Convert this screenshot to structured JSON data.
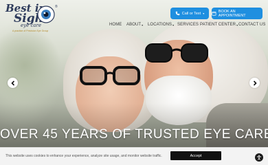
{
  "brand": {
    "logo_line1": "Best in",
    "logo_line2": "Sight",
    "logo_line3": "eye care",
    "logo_tagline": "A practice of Precision Eye Group",
    "registered_mark": "®",
    "logo_color": "#2f3c5c",
    "tagline_color": "#b38a2c"
  },
  "header_buttons": {
    "call": {
      "label": "Call or Text",
      "caret": "▾",
      "icon": "phone-icon"
    },
    "book": {
      "label": "BOOK AN APPOINTMENT",
      "icon": "calendar-icon"
    },
    "color": "#1f8fe0"
  },
  "nav": {
    "items": [
      {
        "label": "HOME",
        "has_menu": false
      },
      {
        "label": "ABOUT",
        "has_menu": true
      },
      {
        "label": "LOCATIONS",
        "has_menu": true
      },
      {
        "label": "SERVICES",
        "has_menu": false
      },
      {
        "label": "PATIENT CENTER",
        "has_menu": true
      },
      {
        "label": "CONTACT US",
        "has_menu": false
      }
    ],
    "caret": "▾"
  },
  "hero": {
    "headline": "OVER 45 YEARS OF TRUSTED EYE CARE",
    "prev_icon": "chevron-left-icon",
    "next_icon": "chevron-right-icon"
  },
  "cookie_bar": {
    "text": "This website uses cookies to enhance your experience, analyze site usage, and monitor website traffic.",
    "accept_label": "Accept",
    "accessibility_icon": "accessibility-icon"
  }
}
